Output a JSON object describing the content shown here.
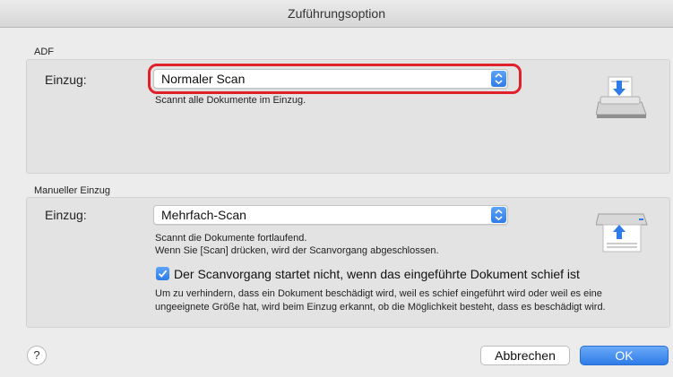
{
  "window": {
    "title": "Zuführungsoption"
  },
  "adf": {
    "section_label": "ADF",
    "feed_label": "Einzug:",
    "feed_value": "Normaler Scan",
    "description": "Scannt alle Dokumente im Einzug."
  },
  "manual": {
    "section_label": "Manueller Einzug",
    "feed_label": "Einzug:",
    "feed_value": "Mehrfach-Scan",
    "description_line1": "Scannt die Dokumente fortlaufend.",
    "description_line2": "Wenn Sie [Scan] drücken, wird der Scanvorgang abgeschlossen.",
    "checkbox_checked": true,
    "checkbox_label": "Der Scanvorgang startet nicht, wenn das eingeführte Dokument schief ist",
    "note_line1": "Um zu verhindern, dass ein Dokument beschädigt wird, weil es schief eingeführt wird oder weil es eine",
    "note_line2": "ungeeignete Größe hat, wird beim Einzug erkannt, ob die Möglichkeit besteht, dass es beschädigt wird."
  },
  "footer": {
    "help_label": "?",
    "cancel_label": "Abbrechen",
    "ok_label": "OK"
  },
  "icons": {
    "adf_scanner": "scanner-adf-icon",
    "manual_scanner": "scanner-manual-icon",
    "stepper": "chevron-updown-icon",
    "check": "checkmark-icon"
  },
  "colors": {
    "accent": "#2f7ce8",
    "highlight": "#e0202a"
  }
}
